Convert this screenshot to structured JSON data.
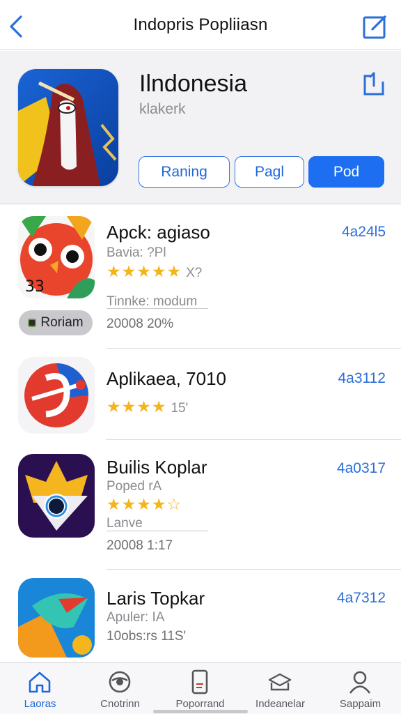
{
  "nav": {
    "title": "Indopris Popliiasn"
  },
  "hero": {
    "name": "Ilndonesia",
    "subtitle": "klakerk",
    "buttons": [
      "Raning",
      "Pagl",
      "Pod"
    ]
  },
  "apps": [
    {
      "name": "Apck: agiaso",
      "price": "4a24l5",
      "developer": "Bavia: ?Pl",
      "stars": "★★★★★",
      "rating_text": "X?",
      "subtitle": "Tinnke: modum",
      "badge": "Roriam",
      "meta": "20008 20%"
    },
    {
      "name": "Aplikaea, 7010",
      "price": "4a3112",
      "stars": "★★★★",
      "rating_text": "15'"
    },
    {
      "name": "Builis Koplar",
      "price": "4a0317",
      "developer": "Poped rA",
      "stars": "★★★★☆",
      "subtitle": "Lanve",
      "meta": "20008 1:17"
    },
    {
      "name": "Laris Topkar",
      "price": "4a7312",
      "developer": "Apuler: IA",
      "meta": "10obs:rs 11S'"
    }
  ],
  "tabs": [
    {
      "label": "Laoras",
      "icon": "home-icon",
      "active": true
    },
    {
      "label": "Cnotrinn",
      "icon": "globe-icon",
      "active": false
    },
    {
      "label": "Poporrand",
      "icon": "phone-icon",
      "active": false
    },
    {
      "label": "Indeanelar",
      "icon": "stack-icon",
      "active": false
    },
    {
      "label": "Sappaim",
      "icon": "person-icon",
      "active": false
    }
  ],
  "colors": {
    "accent": "#1d6ef0",
    "star": "#f3b51b",
    "background": "#ffffff",
    "hero_bg": "#f2f2f5"
  }
}
